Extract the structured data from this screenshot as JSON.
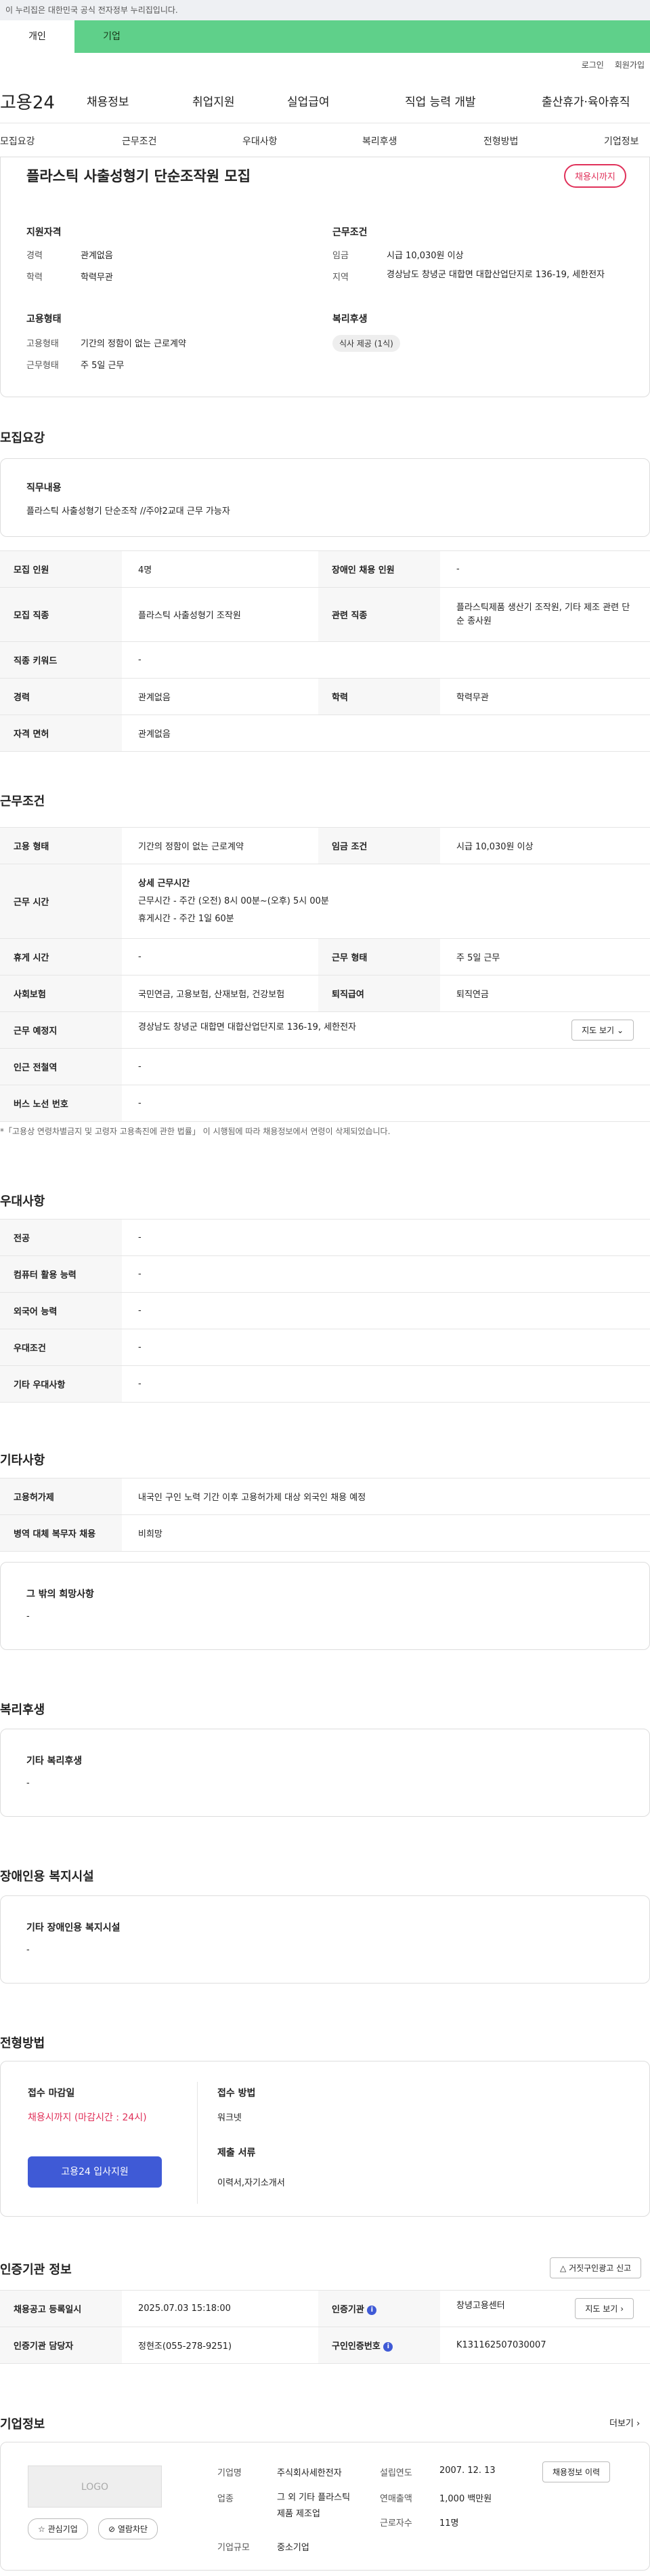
{
  "gov_banner": "이 누리집은 대한민국 공식 전자정부 누리집입니다.",
  "user_tabs": [
    "개인",
    "기업"
  ],
  "util": {
    "login": "로그인",
    "join": "회원가입"
  },
  "gnb": {
    "logo": "고용24",
    "menu": [
      "채용정보",
      "취업지원",
      "실업급여",
      "직업 능력 개발",
      "출산휴가·육아휴직"
    ]
  },
  "tabs": [
    "모집요강",
    "근무조건",
    "우대사항",
    "복리후생",
    "전형방법",
    "기업정보"
  ],
  "job": {
    "title": "플라스틱 사출성형기 단순조작원 모집",
    "badge": "채용시까지"
  },
  "summary": {
    "qual_title": "지원자격",
    "qual": [
      {
        "k": "경력",
        "v": "관계없음"
      },
      {
        "k": "학력",
        "v": "학력무관"
      }
    ],
    "emp_title": "고용형태",
    "emp": [
      {
        "k": "고용형태",
        "v": "기간의 정함이 없는 근로계약"
      },
      {
        "k": "근무형태",
        "v": "주 5일 근무"
      }
    ],
    "cond_title": "근무조건",
    "cond": [
      {
        "k": "임금",
        "v": "시급 10,030원 이상"
      },
      {
        "k": "지역",
        "v": "경상남도 창녕군 대합면 대합산업단지로 136-19, 세한전자"
      }
    ],
    "welfare_title": "복리후생",
    "welfare_pill": "식사 제공 (1식)"
  },
  "recruit": {
    "title": "모집요강",
    "duty_title": "직무내용",
    "duty": "플라스틱 사출성형기 단순조작 //주야2교대 근무 가능자",
    "rows": [
      {
        "k1": "모집 인원",
        "v1": "4명",
        "k2": "장애인 채용 인원",
        "v2": "-"
      },
      {
        "k1": "모집 직종",
        "v1": "플라스틱 사출성형기 조작원",
        "k2": "관련 직종",
        "v2": "플라스틱제품 생산기 조작원, 기타 제조 관련 단순 종사원"
      },
      {
        "k1": "직종 키워드",
        "v1": "-"
      },
      {
        "k1": "경력",
        "v1": "관계없음",
        "k2": "학력",
        "v2": "학력무관"
      },
      {
        "k1": "자격 면허",
        "v1": "관계없음"
      }
    ]
  },
  "work": {
    "title": "근무조건",
    "r1": {
      "k1": "고용 형태",
      "v1": "기간의 정함이 없는 근로계약",
      "k2": "임금 조건",
      "v2": "시급 10,030원 이상"
    },
    "r2": {
      "k": "근무 시간",
      "h": "상세 근무시간",
      "l1": "근무시간 - 주간 (오전) 8시 00분~(오후) 5시 00분",
      "l2": "휴게시간 - 주간 1일 60분"
    },
    "r3": {
      "k1": "휴게 시간",
      "v1": "-",
      "k2": "근무 형태",
      "v2": "주 5일 근무"
    },
    "r4": {
      "k1": "사회보험",
      "v1": "국민연금, 고용보험, 산재보험, 건강보험",
      "k2": "퇴직급여",
      "v2": "퇴직연금"
    },
    "r5": {
      "k": "근무 예정지",
      "v": "경상남도 창녕군 대합면 대합산업단지로 136-19, 세한전자",
      "btn": "지도 보기"
    },
    "r6": {
      "k": "인근 전철역",
      "v": "-"
    },
    "r7": {
      "k": "버스 노선 번호",
      "v": "-"
    },
    "note": "*「고용상 연령차별금지 및 고령자 고용촉진에 관한 법률」 이 시행됨에 따라 채용정보에서 연령이 삭제되었습니다."
  },
  "pref": {
    "title": "우대사항",
    "rows": [
      {
        "k": "전공",
        "v": "-"
      },
      {
        "k": "컴퓨터 활용 능력",
        "v": "-"
      },
      {
        "k": "외국어 능력",
        "v": "-"
      },
      {
        "k": "우대조건",
        "v": "-"
      },
      {
        "k": "기타 우대사항",
        "v": "-"
      }
    ]
  },
  "etc": {
    "title": "기타사항",
    "rows": [
      {
        "k": "고용허가제",
        "v": "내국인 구인 노력 기간 이후 고용허가제 대상 외국인 채용 예정"
      },
      {
        "k": "병역 대체 복무자 채용",
        "v": "비희망"
      }
    ],
    "box_title": "그 밖의 희망사항",
    "box_val": "-"
  },
  "welfare": {
    "title": "복리후생",
    "box_title": "기타 복리후생",
    "box_val": "-"
  },
  "disabled": {
    "title": "장애인용 복지시설",
    "box_title": "기타 장애인용 복지시설",
    "box_val": "-"
  },
  "screening": {
    "title": "전형방법",
    "deadline_title": "접수 마감일",
    "deadline": "채용시까지 (마감시간 : 24시)",
    "apply_btn": "고용24 입사지원",
    "method_title": "접수 방법",
    "method": "워크넷",
    "docs_title": "제출 서류",
    "docs": "이력서,자기소개서"
  },
  "cert": {
    "title": "인증기관 정보",
    "report_btn": "거짓구인광고 신고",
    "r1": {
      "k1": "채용공고 등록일시",
      "v1": "2025.07.03 15:18:00",
      "k2": "인증기관",
      "v2": "창녕고용센터",
      "btn": "지도 보기"
    },
    "r2": {
      "k1": "인증기관 담당자",
      "v1": "정현조(055-278-9251)",
      "k2": "구인인증번호",
      "v2": "K131162507030007"
    }
  },
  "company": {
    "title": "기업정보",
    "more": "더보기",
    "logo": "LOGO",
    "fav_btn": "관심기업",
    "block_btn": "열람차단",
    "name_k": "기업명",
    "name": "주식회사세한전자",
    "ind_k": "업종",
    "ind": "그 외 기타 플라스틱 제품 제조업",
    "size_k": "기업규모",
    "size": "중소기업",
    "year_k": "설립연도",
    "year": "2007. 12. 13",
    "sales_k": "연매출액",
    "sales": "1,000 백만원",
    "emp_k": "근로자수",
    "emp": "11명",
    "hist_btn": "채용정보 이력"
  }
}
